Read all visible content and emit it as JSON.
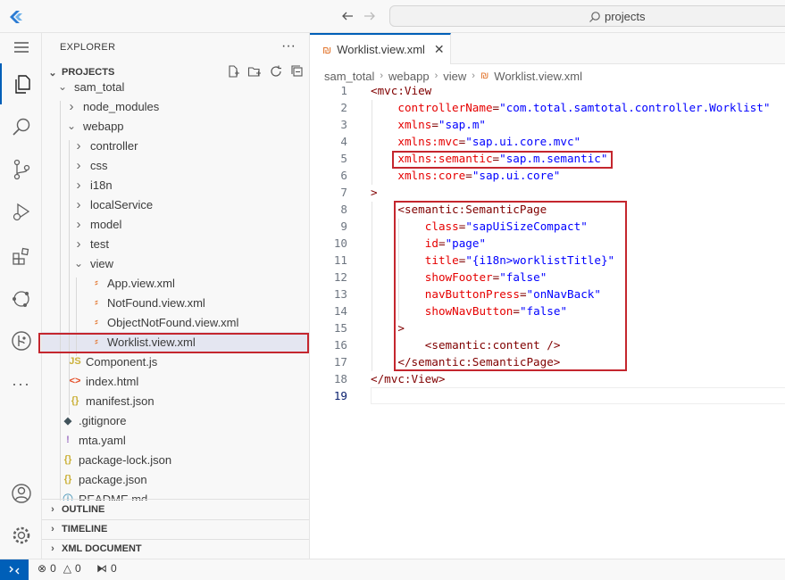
{
  "titlebar": {
    "search_text": "projects"
  },
  "sidebar": {
    "title": "EXPLORER",
    "more": "···",
    "projects_label": "PROJECTS",
    "tree": [
      {
        "label": "sam_total",
        "type": "folder-open",
        "depth": 1
      },
      {
        "label": "node_modules",
        "type": "folder",
        "depth": 2
      },
      {
        "label": "webapp",
        "type": "folder-open",
        "depth": 2
      },
      {
        "label": "controller",
        "type": "folder",
        "depth": 3
      },
      {
        "label": "css",
        "type": "folder",
        "depth": 3
      },
      {
        "label": "i18n",
        "type": "folder",
        "depth": 3
      },
      {
        "label": "localService",
        "type": "folder",
        "depth": 3
      },
      {
        "label": "model",
        "type": "folder",
        "depth": 3
      },
      {
        "label": "test",
        "type": "folder",
        "depth": 3
      },
      {
        "label": "view",
        "type": "folder-open",
        "depth": 3
      },
      {
        "label": "App.view.xml",
        "type": "xml",
        "depth": 4
      },
      {
        "label": "NotFound.view.xml",
        "type": "xml",
        "depth": 4
      },
      {
        "label": "ObjectNotFound.view.xml",
        "type": "xml",
        "depth": 4
      },
      {
        "label": "Worklist.view.xml",
        "type": "xml",
        "depth": 4,
        "selected": true
      },
      {
        "label": "Component.js",
        "type": "js",
        "depth": 3
      },
      {
        "label": "index.html",
        "type": "html",
        "depth": 3
      },
      {
        "label": "manifest.json",
        "type": "json",
        "depth": 3
      },
      {
        "label": ".gitignore",
        "type": "git",
        "depth": 2
      },
      {
        "label": "mta.yaml",
        "type": "yaml",
        "depth": 2
      },
      {
        "label": "package-lock.json",
        "type": "json",
        "depth": 2
      },
      {
        "label": "package.json",
        "type": "json",
        "depth": 2
      },
      {
        "label": "README.md",
        "type": "md",
        "depth": 2
      }
    ],
    "sections": [
      "OUTLINE",
      "TIMELINE",
      "XML DOCUMENT"
    ]
  },
  "editor": {
    "tab_label": "Worklist.view.xml",
    "tab_close": "✕",
    "breadcrumb": [
      "sam_total",
      "webapp",
      "view",
      "Worklist.view.xml"
    ],
    "lines": [
      {
        "n": "1",
        "indent": 0,
        "parts": [
          [
            "t-tag",
            "<mvc:View"
          ]
        ]
      },
      {
        "n": "2",
        "indent": 4,
        "parts": [
          [
            "t-attr",
            "controllerName"
          ],
          [
            "t-punct",
            "="
          ],
          [
            "t-val",
            "\"com.total.samtotal.controller.Worklist\""
          ]
        ]
      },
      {
        "n": "3",
        "indent": 4,
        "parts": [
          [
            "t-attr",
            "xmlns"
          ],
          [
            "t-punct",
            "="
          ],
          [
            "t-val",
            "\"sap.m\""
          ]
        ]
      },
      {
        "n": "4",
        "indent": 4,
        "parts": [
          [
            "t-attr",
            "xmlns:mvc"
          ],
          [
            "t-punct",
            "="
          ],
          [
            "t-val",
            "\"sap.ui.core.mvc\""
          ]
        ]
      },
      {
        "n": "5",
        "indent": 4,
        "parts": [
          [
            "t-attr",
            "xmlns:semantic"
          ],
          [
            "t-punct",
            "="
          ],
          [
            "t-val",
            "\"sap.m.semantic\""
          ]
        ]
      },
      {
        "n": "6",
        "indent": 4,
        "parts": [
          [
            "t-attr",
            "xmlns:core"
          ],
          [
            "t-punct",
            "="
          ],
          [
            "t-val",
            "\"sap.ui.core\""
          ]
        ]
      },
      {
        "n": "7",
        "indent": 0,
        "parts": [
          [
            "t-tag",
            ">"
          ]
        ]
      },
      {
        "n": "8",
        "indent": 4,
        "parts": [
          [
            "t-tag",
            "<semantic:SemanticPage"
          ]
        ]
      },
      {
        "n": "9",
        "indent": 8,
        "parts": [
          [
            "t-attr",
            "class"
          ],
          [
            "t-punct",
            "="
          ],
          [
            "t-val",
            "\"sapUiSizeCompact\""
          ]
        ]
      },
      {
        "n": "10",
        "indent": 8,
        "parts": [
          [
            "t-attr",
            "id"
          ],
          [
            "t-punct",
            "="
          ],
          [
            "t-val",
            "\"page\""
          ]
        ]
      },
      {
        "n": "11",
        "indent": 8,
        "parts": [
          [
            "t-attr",
            "title"
          ],
          [
            "t-punct",
            "="
          ],
          [
            "t-val",
            "\"{i18n>worklistTitle}\""
          ]
        ]
      },
      {
        "n": "12",
        "indent": 8,
        "parts": [
          [
            "t-attr",
            "showFooter"
          ],
          [
            "t-punct",
            "="
          ],
          [
            "t-val",
            "\"false\""
          ]
        ]
      },
      {
        "n": "13",
        "indent": 8,
        "parts": [
          [
            "t-attr",
            "navButtonPress"
          ],
          [
            "t-punct",
            "="
          ],
          [
            "t-val",
            "\"onNavBack\""
          ]
        ]
      },
      {
        "n": "14",
        "indent": 8,
        "parts": [
          [
            "t-attr",
            "showNavButton"
          ],
          [
            "t-punct",
            "="
          ],
          [
            "t-val",
            "\"false\""
          ]
        ]
      },
      {
        "n": "15",
        "indent": 4,
        "parts": [
          [
            "t-tag",
            ">"
          ]
        ]
      },
      {
        "n": "16",
        "indent": 8,
        "parts": [
          [
            "t-tag",
            "<semantic:content />"
          ]
        ]
      },
      {
        "n": "17",
        "indent": 4,
        "parts": [
          [
            "t-tag",
            "</semantic:SemanticPage>"
          ]
        ]
      },
      {
        "n": "18",
        "indent": 0,
        "parts": [
          [
            "t-tag",
            "</mvc:View>"
          ]
        ]
      },
      {
        "n": "19",
        "indent": 0,
        "parts": []
      }
    ]
  },
  "status": {
    "errors": "0",
    "warnings": "0",
    "ports": "0"
  },
  "colors": {
    "accent": "#005fb8",
    "highlight_box": "#c4262e",
    "xml_icon": "#e37933",
    "js_icon": "#cbb13a",
    "json_icon": "#cbb13a",
    "yaml_icon": "#a074c4"
  }
}
